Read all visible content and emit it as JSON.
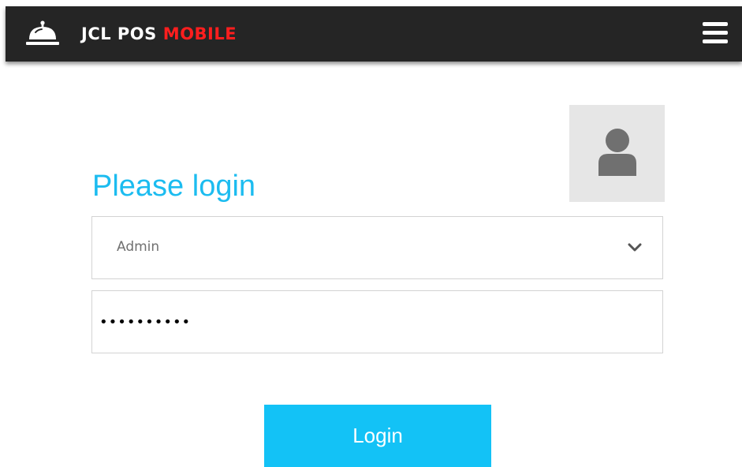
{
  "header": {
    "brand_main": "JCL POS",
    "brand_accent": "MOBILE",
    "logo_icon": "service-bell-icon",
    "menu_icon": "hamburger-menu-icon"
  },
  "login": {
    "title": "Please login",
    "avatar_icon": "user-avatar-icon",
    "user_select": {
      "value": "Admin",
      "icon": "chevron-down-icon"
    },
    "password": {
      "value": "••••••••••"
    },
    "submit_label": "Login"
  },
  "colors": {
    "header_bg": "#252525",
    "brand_accent": "#ff1e1e",
    "title": "#1cbcf0",
    "button_bg": "#13c2f6",
    "avatar_bg": "#e6e6e6"
  }
}
